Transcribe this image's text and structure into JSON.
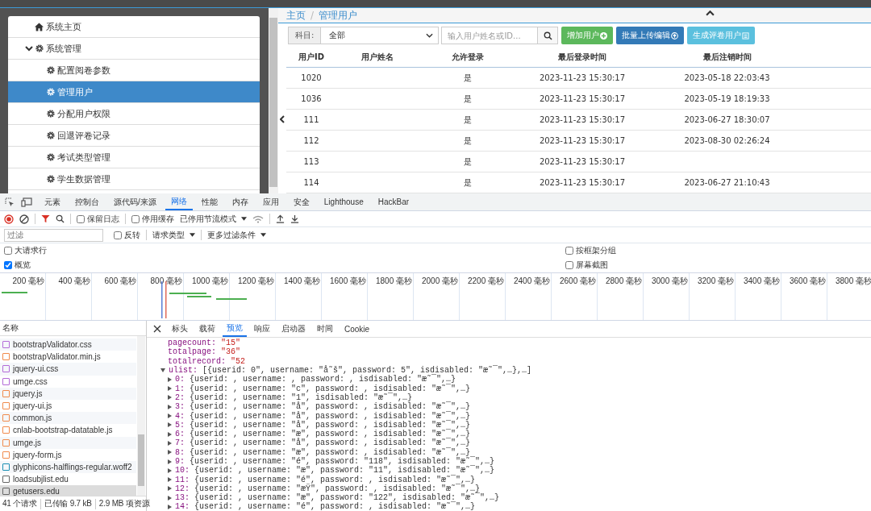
{
  "sidebar": {
    "items": [
      {
        "label": "系统主页",
        "selected": false
      },
      {
        "label": "系统管理",
        "selected": false,
        "expanded": true,
        "children": [
          {
            "label": "配置阅卷参数",
            "selected": false
          },
          {
            "label": "管理用户",
            "selected": true
          },
          {
            "label": "分配用户权限",
            "selected": false
          },
          {
            "label": "回退评卷记录",
            "selected": false
          },
          {
            "label": "考试类型管理",
            "selected": false
          },
          {
            "label": "学生数据管理",
            "selected": false
          }
        ]
      }
    ]
  },
  "breadcrumb": {
    "items": [
      "主页",
      "管理用户"
    ],
    "separator": "/"
  },
  "filter": {
    "label": "科目:",
    "value": "全部",
    "search_placeholder": "输入用户姓名或ID..."
  },
  "buttons": [
    {
      "label": "增加用户",
      "kind": "success"
    },
    {
      "label": "批量上传编辑",
      "kind": "primary"
    },
    {
      "label": "生成评卷用户",
      "kind": "info"
    }
  ],
  "table": {
    "columns": [
      "用户ID",
      "用户姓名",
      "允许登录",
      "最后登录时间",
      "最后注销时间"
    ],
    "rows": [
      [
        "1020",
        "",
        "是",
        "2023-11-23 15:30:17",
        "2023-05-18 22:03:43"
      ],
      [
        "1036",
        "",
        "是",
        "2023-11-23 15:30:17",
        "2023-05-19 18:19:33"
      ],
      [
        "111",
        "",
        "是",
        "2023-11-23 15:30:17",
        "2023-06-27 18:30:07"
      ],
      [
        "112",
        "",
        "是",
        "2023-11-23 15:30:17",
        "2023-08-30 02:26:24"
      ],
      [
        "113",
        "",
        "是",
        "2023-11-23 15:30:17",
        ""
      ],
      [
        "114",
        "",
        "是",
        "2023-11-23 15:30:17",
        "2023-06-27 21:10:43"
      ]
    ]
  },
  "devtools": {
    "tabs": [
      {
        "label": "元素",
        "selected": false
      },
      {
        "label": "控制台",
        "selected": false
      },
      {
        "label": "源代码/来源",
        "selected": false
      },
      {
        "label": "网络",
        "selected": true
      },
      {
        "label": "性能",
        "selected": false
      },
      {
        "label": "内存",
        "selected": false
      },
      {
        "label": "应用",
        "selected": false
      },
      {
        "label": "安全",
        "selected": false
      },
      {
        "label": "Lighthouse",
        "selected": false
      },
      {
        "label": "HackBar",
        "selected": false
      }
    ],
    "toolbar": {
      "preserve_log": {
        "label": "保留日志",
        "checked": false
      },
      "disable_cache": {
        "label": "停用缓存",
        "checked": false
      },
      "throttle": "已停用节流模式"
    },
    "filter_row": {
      "placeholder": "过滤",
      "invert": {
        "label": "反转",
        "checked": false
      },
      "request_type": "请求类型",
      "more_filters": "更多过滤条件"
    },
    "options": [
      {
        "label": "大请求行",
        "checked": false
      },
      {
        "label": "按框架分组",
        "checked": false
      },
      {
        "label": "概览",
        "checked": true
      },
      {
        "label": "屏幕截图",
        "checked": false
      }
    ],
    "timeline_ticks": [
      "200 毫秒",
      "400 毫秒",
      "600 毫秒",
      "800 毫秒",
      "1000 毫秒",
      "1200 毫秒",
      "1400 毫秒",
      "1600 毫秒",
      "1800 毫秒",
      "2000 毫秒",
      "2200 毫秒",
      "2400 毫秒",
      "2600 毫秒",
      "2800 毫秒",
      "3000 毫秒",
      "3200 毫秒",
      "3400 毫秒",
      "3600 毫秒",
      "3800 毫秒"
    ],
    "files_header": "名称",
    "files": [
      {
        "name": "bootstrapValidator.css",
        "kind": "css",
        "selected": false
      },
      {
        "name": "bootstrapValidator.min.js",
        "kind": "js",
        "selected": false
      },
      {
        "name": "jquery-ui.css",
        "kind": "css",
        "selected": false
      },
      {
        "name": "umge.css",
        "kind": "css",
        "selected": false
      },
      {
        "name": "jquery.js",
        "kind": "js",
        "selected": false
      },
      {
        "name": "jquery-ui.js",
        "kind": "js",
        "selected": false
      },
      {
        "name": "common.js",
        "kind": "js",
        "selected": false
      },
      {
        "name": "cnlab-bootstrap-datatable.js",
        "kind": "js",
        "selected": false
      },
      {
        "name": "umge.js",
        "kind": "js",
        "selected": false
      },
      {
        "name": "jquery-form.js",
        "kind": "js",
        "selected": false
      },
      {
        "name": "glyphicons-halflings-regular.woff2",
        "kind": "font",
        "selected": false
      },
      {
        "name": "loadsubjlist.edu",
        "kind": "doc",
        "selected": false
      },
      {
        "name": "getusers.edu",
        "kind": "doc",
        "selected": true
      }
    ],
    "status": [
      "41 个请求",
      "已传输 9.7 kB",
      "2.9 MB 项资源"
    ],
    "detail_tabs": [
      {
        "label": "标头",
        "selected": false
      },
      {
        "label": "载荷",
        "selected": false
      },
      {
        "label": "预览",
        "selected": true
      },
      {
        "label": "响应",
        "selected": false
      },
      {
        "label": "启动器",
        "selected": false
      },
      {
        "label": "时间",
        "selected": false
      },
      {
        "label": "Cookie",
        "selected": false
      }
    ],
    "preview": [
      {
        "key": "pagecount:",
        "value": "\"15\""
      },
      {
        "key": "totalpage:",
        "value": "\"36\""
      },
      {
        "key": "totalrecord:",
        "value": "\"52"
      },
      {
        "key": "ulist:",
        "value": "[{userid: 0\", username: \"å˜š\", password: 5\", isdisabled: \"æ˜¯\",…},…]",
        "expanded": true,
        "children": [
          {
            "key": "0:",
            "value": "{userid: , username: , password: , isdisabled: \"æ˜¯\",…}",
            "expanded": false
          },
          {
            "key": "1:",
            "value": "{userid: , username: \"c\", password: , isdisabled: \"æ˜¯\",…}",
            "expanded": false
          },
          {
            "key": "2:",
            "value": "{userid: , username: \"1\", isdisabled: \"æ˜¯\",…}",
            "expanded": false
          },
          {
            "key": "3:",
            "value": "{userid: , username: \"å\", password: , isdisabled: \"æ˜¯\",…}",
            "expanded": false
          },
          {
            "key": "4:",
            "value": "{userid: , username: \"å\", password: , isdisabled: \"æ˜¯\",…}",
            "expanded": false
          },
          {
            "key": "5:",
            "value": "{userid: , username: \"å\", password: , isdisabled: \"æ˜¯\",…}",
            "expanded": false
          },
          {
            "key": "6:",
            "value": "{userid: , username: \"æ\", password: , isdisabled: \"æ˜¯\",…}",
            "expanded": false
          },
          {
            "key": "7:",
            "value": "{userid: , username: \"å\", password: , isdisabled: \"æ˜¯\",…}",
            "expanded": false
          },
          {
            "key": "8:",
            "value": "{userid: , username: \"æ\", password: , isdisabled: \"æ˜¯\",…}",
            "expanded": false
          },
          {
            "key": "9:",
            "value": "{userid: , username: \"é\", password: \"118\", isdisabled: \"æ˜¯\",…}",
            "expanded": false
          },
          {
            "key": "10:",
            "value": "{userid: , username: \"æ\", password: \"11\", isdisabled: \"æ˜¯\",…}",
            "expanded": false
          },
          {
            "key": "11:",
            "value": "{userid: , username: \"é\", password: , isdisabled: \"æ˜¯\",…}",
            "expanded": false
          },
          {
            "key": "12:",
            "value": "{userid: , username: \"æŸ\", password: , isdisabled: \"æ˜¯\",…}",
            "expanded": false
          },
          {
            "key": "13:",
            "value": "{userid: , username: \"æ\", password: \"122\", isdisabled: \"æ˜¯\",…}",
            "expanded": false
          },
          {
            "key": "14:",
            "value": "{userid: , username: \"é\", password: , isdisabled: \"æ˜¯\",…}",
            "expanded": false
          }
        ]
      }
    ]
  }
}
